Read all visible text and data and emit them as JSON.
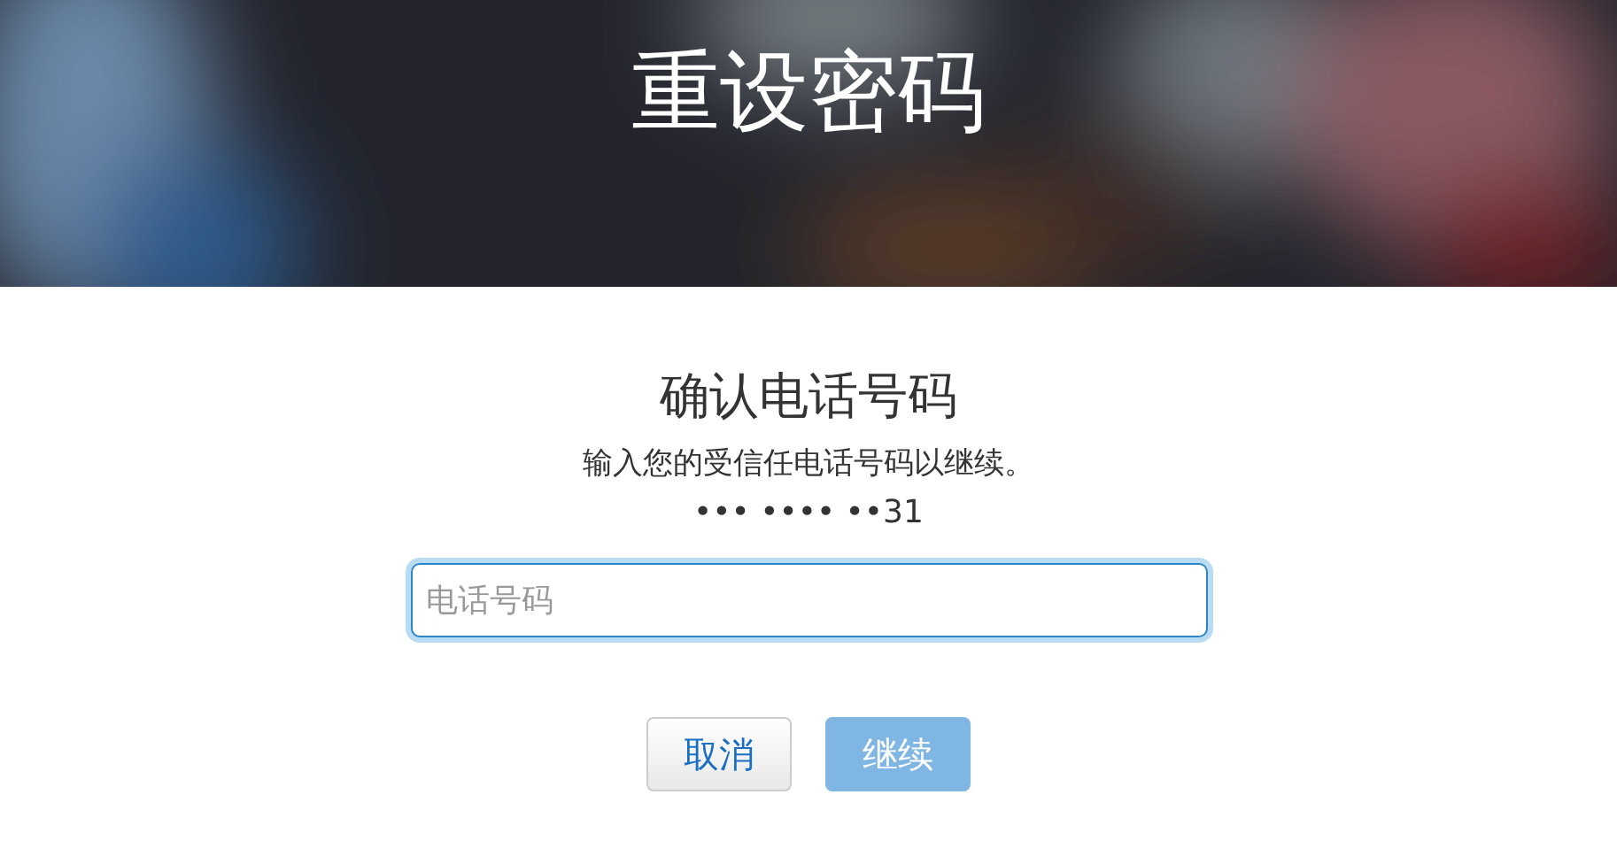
{
  "header": {
    "title": "重设密码"
  },
  "form": {
    "heading": "确认电话号码",
    "instruction": "输入您的受信任电话号码以继续。",
    "masked_number": "••• •••• ••31",
    "phone_field": {
      "placeholder": "电话号码",
      "focused": true
    },
    "buttons": [
      {
        "label": "取消",
        "kind": "secondary",
        "disabled": false
      },
      {
        "label": "继续",
        "kind": "primary",
        "disabled": true
      }
    ]
  }
}
